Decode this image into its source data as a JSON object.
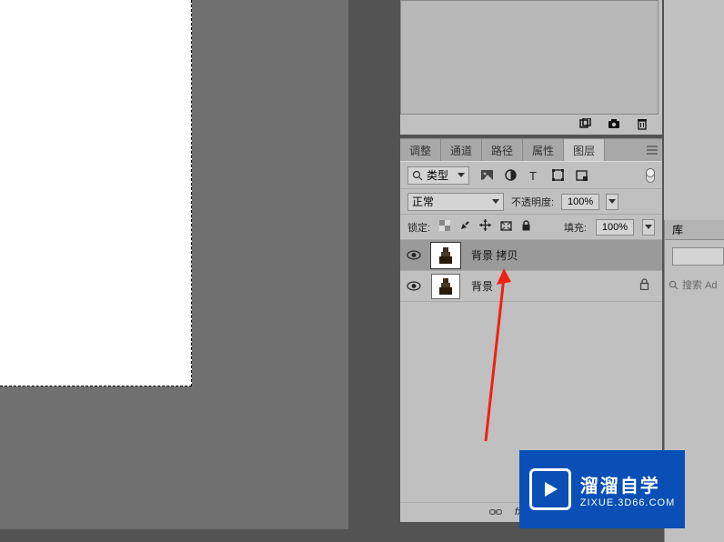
{
  "tabs": {
    "adjustments": "调整",
    "channels": "通道",
    "paths": "路径",
    "properties": "属性",
    "layers": "图层"
  },
  "filter": {
    "kind_label": "类型"
  },
  "blend": {
    "mode": "正常",
    "opacity_label": "不透明度:",
    "opacity_value": "100%"
  },
  "lock": {
    "label": "锁定:",
    "fill_label": "填充:",
    "fill_value": "100%"
  },
  "layers": [
    {
      "name": "背景 拷贝",
      "locked": false,
      "selected": true
    },
    {
      "name": "背景",
      "locked": true,
      "selected": false
    }
  ],
  "library": {
    "tab": "库",
    "search_placeholder": "搜索 Ad"
  },
  "watermark": {
    "line1": "溜溜自学",
    "line2": "ZIXUE.3D66.COM"
  }
}
